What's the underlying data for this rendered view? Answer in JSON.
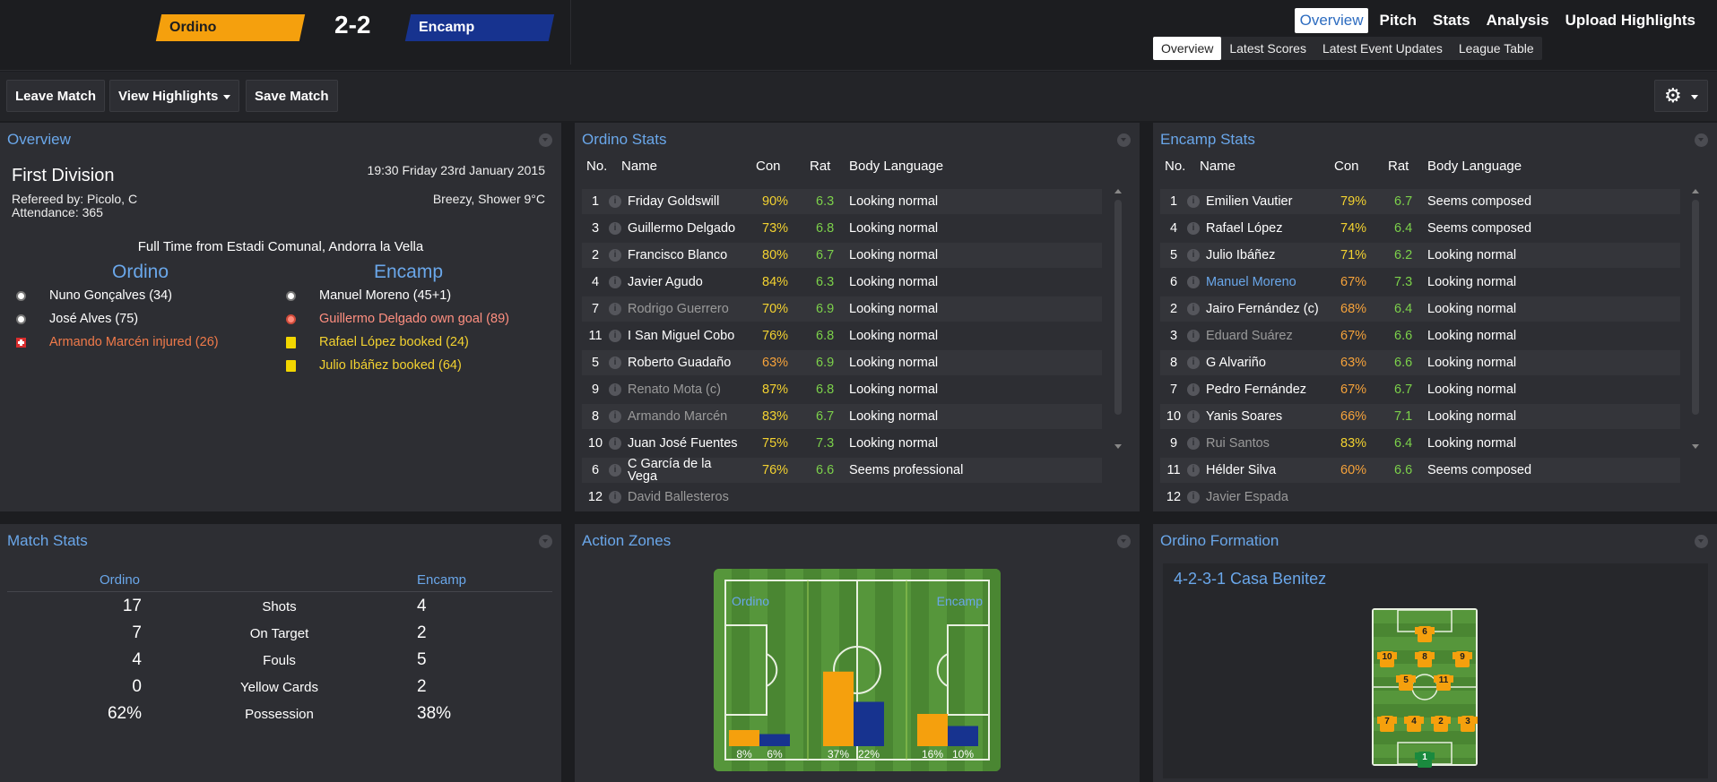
{
  "match": {
    "home_team": "Ordino",
    "away_team": "Encamp",
    "score": "2-2",
    "home_color": "#f5a00d",
    "away_color": "#17338f"
  },
  "topnav": {
    "items": [
      "Overview",
      "Pitch",
      "Stats",
      "Analysis",
      "Upload Highlights"
    ],
    "active": "Overview"
  },
  "subnav": {
    "items": [
      "Overview",
      "Latest Scores",
      "Latest Event Updates",
      "League Table"
    ],
    "active": "Overview"
  },
  "toolbar": {
    "leave": "Leave Match",
    "highlights": "View Highlights",
    "save": "Save Match",
    "settings_icon": "gear-icon"
  },
  "overview": {
    "title": "Overview",
    "competition": "First Division",
    "referee": "Refereed by: Picolo, C",
    "attendance": "Attendance: 365",
    "datetime": "19:30 Friday 23rd January 2015",
    "weather": "Breezy, Shower 9°C",
    "fulltime": "Full Time from Estadi Comunal, Andorra la Vella",
    "home_label": "Ordino",
    "away_label": "Encamp",
    "home_events": [
      {
        "type": "goal",
        "text": "Nuno Gonçalves (34)"
      },
      {
        "type": "goal",
        "text": "José Alves (75)"
      },
      {
        "type": "injury",
        "text": "Armando Marcén injured (26)"
      }
    ],
    "away_events": [
      {
        "type": "goal",
        "text": "Manuel Moreno (45+1)"
      },
      {
        "type": "own-goal",
        "text": "Guillermo Delgado own goal (89)"
      },
      {
        "type": "booking",
        "text": "Rafael López booked (24)"
      },
      {
        "type": "booking",
        "text": "Julio Ibáñez booked (64)"
      }
    ]
  },
  "columns": {
    "no": "No.",
    "name": "Name",
    "con": "Con",
    "rat": "Rat",
    "body": "Body Language"
  },
  "ordino_stats": {
    "title": "Ordino Stats",
    "rows": [
      {
        "no": "1",
        "name": "Friday Goldswill",
        "con": "90%",
        "rat": "6.3",
        "body": "Looking normal",
        "dim": false
      },
      {
        "no": "3",
        "name": "Guillermo Delgado",
        "con": "73%",
        "rat": "6.8",
        "body": "Looking normal",
        "dim": false
      },
      {
        "no": "2",
        "name": "Francisco Blanco",
        "con": "80%",
        "rat": "6.7",
        "body": "Looking normal",
        "dim": false
      },
      {
        "no": "4",
        "name": "Javier Agudo",
        "con": "84%",
        "rat": "6.3",
        "body": "Looking normal",
        "dim": false
      },
      {
        "no": "7",
        "name": "Rodrigo Guerrero",
        "con": "70%",
        "rat": "6.9",
        "body": "Looking normal",
        "dim": true
      },
      {
        "no": "11",
        "name": "I San Miguel Cobo",
        "con": "76%",
        "rat": "6.8",
        "body": "Looking normal",
        "dim": false
      },
      {
        "no": "5",
        "name": "Roberto Guadaño",
        "con": "63%",
        "rat": "6.9",
        "body": "Looking normal",
        "dim": false
      },
      {
        "no": "9",
        "name": "Renato Mota (c)",
        "con": "87%",
        "rat": "6.8",
        "body": "Looking normal",
        "dim": true
      },
      {
        "no": "8",
        "name": "Armando Marcén",
        "con": "83%",
        "rat": "6.7",
        "body": "Looking normal",
        "dim": true
      },
      {
        "no": "10",
        "name": "Juan José Fuentes",
        "con": "75%",
        "rat": "7.3",
        "body": "Looking normal",
        "dim": false
      },
      {
        "no": "6",
        "name": "C García de la Vega",
        "con": "76%",
        "rat": "6.6",
        "body": "Seems professional",
        "dim": false
      },
      {
        "no": "12",
        "name": "David Ballesteros",
        "con": "",
        "rat": "",
        "body": "",
        "dim": true
      }
    ]
  },
  "encamp_stats": {
    "title": "Encamp Stats",
    "rows": [
      {
        "no": "1",
        "name": "Emilien Vautier",
        "con": "79%",
        "rat": "6.7",
        "body": "Seems composed",
        "dim": false
      },
      {
        "no": "4",
        "name": "Rafael López",
        "con": "74%",
        "rat": "6.4",
        "body": "Seems composed",
        "dim": false
      },
      {
        "no": "5",
        "name": "Julio Ibáñez",
        "con": "71%",
        "rat": "6.2",
        "body": "Looking normal",
        "dim": false
      },
      {
        "no": "6",
        "name": "Manuel Moreno",
        "con": "67%",
        "rat": "7.3",
        "body": "Looking normal",
        "dim": false,
        "highlight": true
      },
      {
        "no": "2",
        "name": "Jairo Fernández (c)",
        "con": "68%",
        "rat": "6.4",
        "body": "Looking normal",
        "dim": false
      },
      {
        "no": "3",
        "name": "Eduard Suárez",
        "con": "67%",
        "rat": "6.6",
        "body": "Looking normal",
        "dim": true
      },
      {
        "no": "8",
        "name": "G Alvariño",
        "con": "63%",
        "rat": "6.6",
        "body": "Looking normal",
        "dim": false
      },
      {
        "no": "7",
        "name": "Pedro Fernández",
        "con": "67%",
        "rat": "6.7",
        "body": "Looking normal",
        "dim": false
      },
      {
        "no": "10",
        "name": "Yanis Soares",
        "con": "66%",
        "rat": "7.1",
        "body": "Looking normal",
        "dim": false
      },
      {
        "no": "9",
        "name": "Rui Santos",
        "con": "83%",
        "rat": "6.4",
        "body": "Looking normal",
        "dim": true
      },
      {
        "no": "11",
        "name": "Hélder Silva",
        "con": "60%",
        "rat": "6.6",
        "body": "Seems composed",
        "dim": false
      },
      {
        "no": "12",
        "name": "Javier Espada",
        "con": "",
        "rat": "",
        "body": "",
        "dim": true
      }
    ]
  },
  "match_stats": {
    "title": "Match Stats",
    "home": "Ordino",
    "away": "Encamp",
    "rows": [
      {
        "label": "Shots",
        "home": "17",
        "away": "4"
      },
      {
        "label": "On Target",
        "home": "7",
        "away": "2"
      },
      {
        "label": "Fouls",
        "home": "4",
        "away": "5"
      },
      {
        "label": "Yellow Cards",
        "home": "0",
        "away": "2"
      },
      {
        "label": "Possession",
        "home": "62%",
        "away": "38%"
      }
    ]
  },
  "action_zones": {
    "title": "Action Zones",
    "home_label": "Ordino",
    "away_label": "Encamp",
    "zones": [
      {
        "home": 8,
        "away": 6,
        "home_label": "8%",
        "away_label": "6%"
      },
      {
        "home": 37,
        "away": 22,
        "home_label": "37%",
        "away_label": "22%"
      },
      {
        "home": 16,
        "away": 10,
        "home_label": "16%",
        "away_label": "10%"
      }
    ]
  },
  "formation": {
    "title": "Ordino Formation",
    "name": "4-2-3-1 Casa Benitez",
    "players": [
      "6",
      "10",
      "8",
      "9",
      "5",
      "11",
      "7",
      "4",
      "2",
      "3",
      "1"
    ]
  }
}
